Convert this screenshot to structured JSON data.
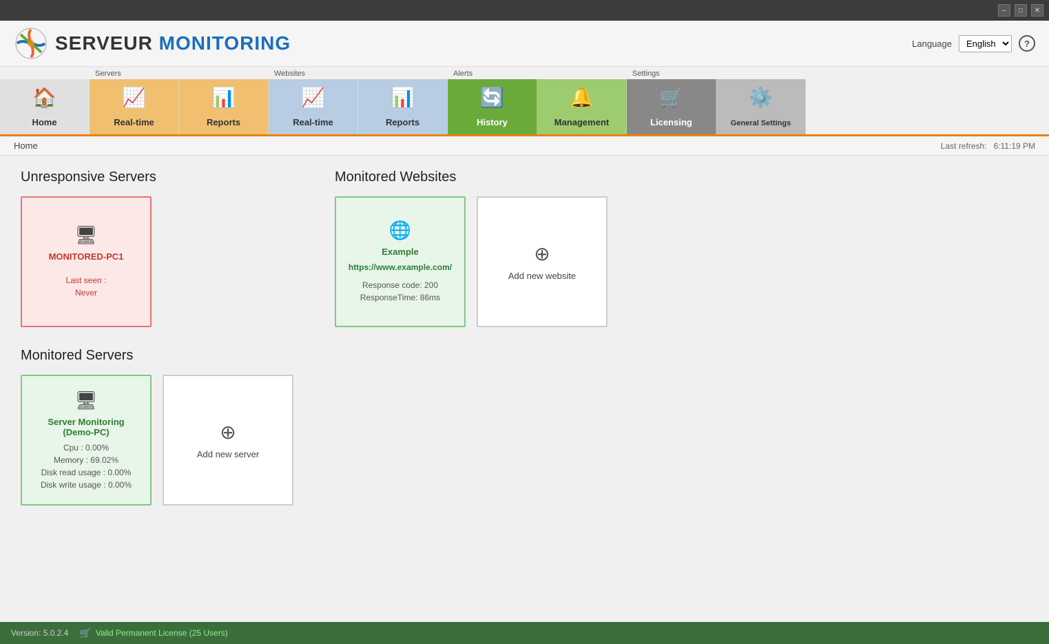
{
  "titleBar": {
    "minimizeLabel": "–",
    "maximizeLabel": "□",
    "closeLabel": "✕"
  },
  "header": {
    "logoServeur": "SERVEUR",
    "logoMonitoring": " MONITORING",
    "languageLabel": "Language",
    "languageValue": "English",
    "helpLabel": "?"
  },
  "nav": {
    "groups": [
      {
        "label": "",
        "items": [
          {
            "id": "home",
            "label": "Home",
            "icon": "🏠",
            "style": "nav-home"
          }
        ]
      },
      {
        "label": "Servers",
        "items": [
          {
            "id": "servers-realtime",
            "label": "Real-time",
            "icon": "📈",
            "style": "nav-servers-rt"
          },
          {
            "id": "servers-reports",
            "label": "Reports",
            "icon": "📊",
            "style": "nav-servers-rep"
          }
        ]
      },
      {
        "label": "Websites",
        "items": [
          {
            "id": "web-realtime",
            "label": "Real-time",
            "icon": "📈",
            "style": "nav-web-rt"
          },
          {
            "id": "web-reports",
            "label": "Reports",
            "icon": "📊",
            "style": "nav-web-rep"
          }
        ]
      },
      {
        "label": "Alerts",
        "items": [
          {
            "id": "alerts-history",
            "label": "History",
            "icon": "🔄",
            "style": "nav-alerts-hist"
          },
          {
            "id": "alerts-management",
            "label": "Management",
            "icon": "🔔",
            "style": "nav-alerts-mgmt"
          }
        ]
      },
      {
        "label": "Settings",
        "items": [
          {
            "id": "settings-licensing",
            "label": "Licensing",
            "icon": "🛒",
            "style": "nav-settings-lic"
          },
          {
            "id": "settings-general",
            "label": "General Settings",
            "icon": "⚙️",
            "style": "nav-settings-gen"
          }
        ]
      }
    ]
  },
  "breadcrumb": {
    "text": "Home",
    "lastRefreshLabel": "Last refresh:",
    "lastRefreshTime": "6:11:19 PM"
  },
  "unresponsiveServers": {
    "title": "Unresponsive Servers",
    "servers": [
      {
        "name": "MONITORED-PC1",
        "lastSeen": "Last seen :",
        "lastSeenValue": "Never",
        "icon": "🖥"
      }
    ]
  },
  "monitoredWebsites": {
    "title": "Monitored Websites",
    "websites": [
      {
        "name": "Example",
        "url": "https://www.example.com/",
        "responseCode": "Response code: 200",
        "responseTime": "ResponseTime: 86ms",
        "icon": "🌐"
      }
    ],
    "addLabel": "Add new website"
  },
  "monitoredServers": {
    "title": "Monitored Servers",
    "servers": [
      {
        "name": "Server Monitoring (Demo-PC)",
        "cpu": "Cpu : 0.00%",
        "memory": "Memory : 69.02%",
        "diskRead": "Disk read usage : 0.00%",
        "diskWrite": "Disk write usage : 0.00%",
        "icon": "🖥"
      }
    ],
    "addLabel": "Add new server"
  },
  "footer": {
    "version": "Version: 5.0.2.4",
    "licenseIcon": "🛒",
    "licenseText": "Valid Permanent License (25 Users)"
  }
}
